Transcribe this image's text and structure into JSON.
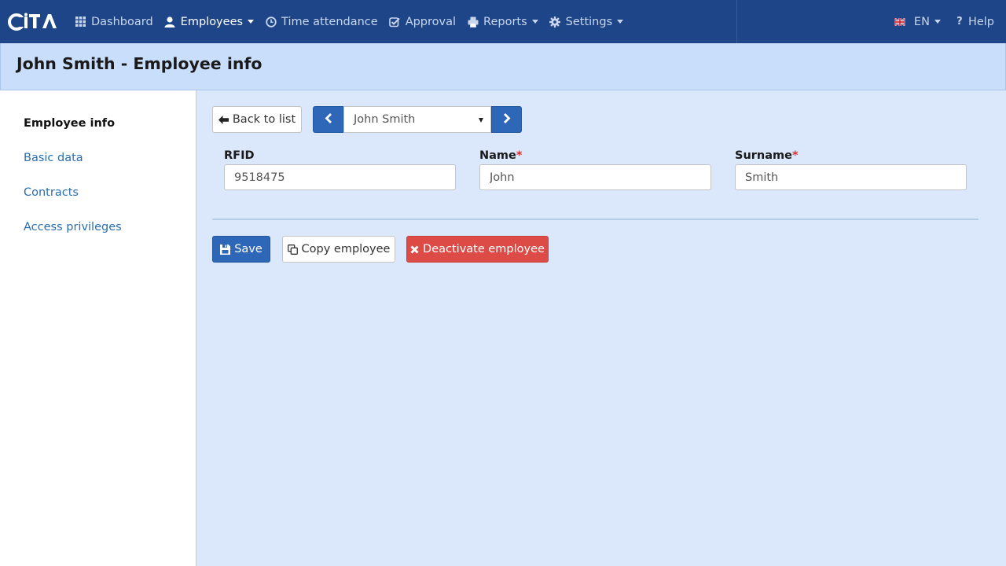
{
  "app": {
    "logo_text": "iTA"
  },
  "nav": {
    "items": [
      {
        "label": "Dashboard",
        "icon": "grid-icon",
        "dropdown": false
      },
      {
        "label": "Employees",
        "icon": "user-icon",
        "dropdown": true,
        "active": true
      },
      {
        "label": "Time attendance",
        "icon": "clock-icon",
        "dropdown": false
      },
      {
        "label": "Approval",
        "icon": "check-square-icon",
        "dropdown": false
      },
      {
        "label": "Reports",
        "icon": "printer-icon",
        "dropdown": true
      },
      {
        "label": "Settings",
        "icon": "gear-icon",
        "dropdown": true
      }
    ],
    "language": "EN",
    "help": "Help"
  },
  "page": {
    "title": "John Smith - Employee info"
  },
  "sidebar": {
    "items": [
      {
        "label": "Employee info",
        "active": true
      },
      {
        "label": "Basic data"
      },
      {
        "label": "Contracts"
      },
      {
        "label": "Access privileges"
      }
    ]
  },
  "toolbar": {
    "back_label": "Back to list",
    "employee_select": "John Smith"
  },
  "form": {
    "rfid": {
      "label": "RFID",
      "value": "9518475"
    },
    "name": {
      "label": "Name",
      "required_mark": "*",
      "value": "John"
    },
    "surname": {
      "label": "Surname",
      "required_mark": "*",
      "value": "Smith"
    }
  },
  "actions": {
    "save": "Save",
    "copy": "Copy employee",
    "deactivate": "Deactivate employee"
  },
  "colors": {
    "navbar": "#1d4587",
    "header": "#c9defb",
    "background": "#dbe8fb",
    "primary": "#2e67b8",
    "danger": "#dd4b47"
  }
}
